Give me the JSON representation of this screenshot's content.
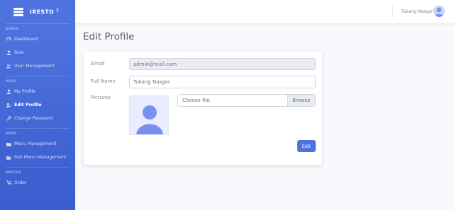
{
  "brand": {
    "name": "IRESTO",
    "superscript": "2"
  },
  "sidebar": {
    "sections": [
      {
        "heading": "ADMIN",
        "items": [
          {
            "label": "Dashboard",
            "icon": "dashboard-icon"
          },
          {
            "label": "Role",
            "icon": "user-icon"
          },
          {
            "label": "User Management",
            "icon": "users-icon"
          }
        ]
      },
      {
        "heading": "USER",
        "items": [
          {
            "label": "My Profile",
            "icon": "user-icon"
          },
          {
            "label": "Edit Profile",
            "icon": "user-edit-icon",
            "active": true
          },
          {
            "label": "Change Password",
            "icon": "key-icon"
          }
        ]
      },
      {
        "heading": "MENU",
        "items": [
          {
            "label": "Menu Management",
            "icon": "folder-icon"
          },
          {
            "label": "Sub Menu Management",
            "icon": "folder-open-icon"
          }
        ]
      },
      {
        "heading": "MASTER",
        "items": [
          {
            "label": "Order",
            "icon": "cart-icon"
          }
        ]
      }
    ]
  },
  "topbar": {
    "user_name": "Tukang Nasgor"
  },
  "page": {
    "title": "Edit Profile"
  },
  "form": {
    "email_label": "Email",
    "email_value": "admin@mail.com",
    "fullname_label": "Full Name",
    "fullname_value": "Tukang Nasgor",
    "pictures_label": "Pictures",
    "file_placeholder": "Choose file",
    "browse_label": "Browse",
    "submit_label": "Edit"
  },
  "colors": {
    "primary": "#4e73df",
    "sidebar_dark": "#3a5ccf",
    "text_muted": "#858796"
  }
}
